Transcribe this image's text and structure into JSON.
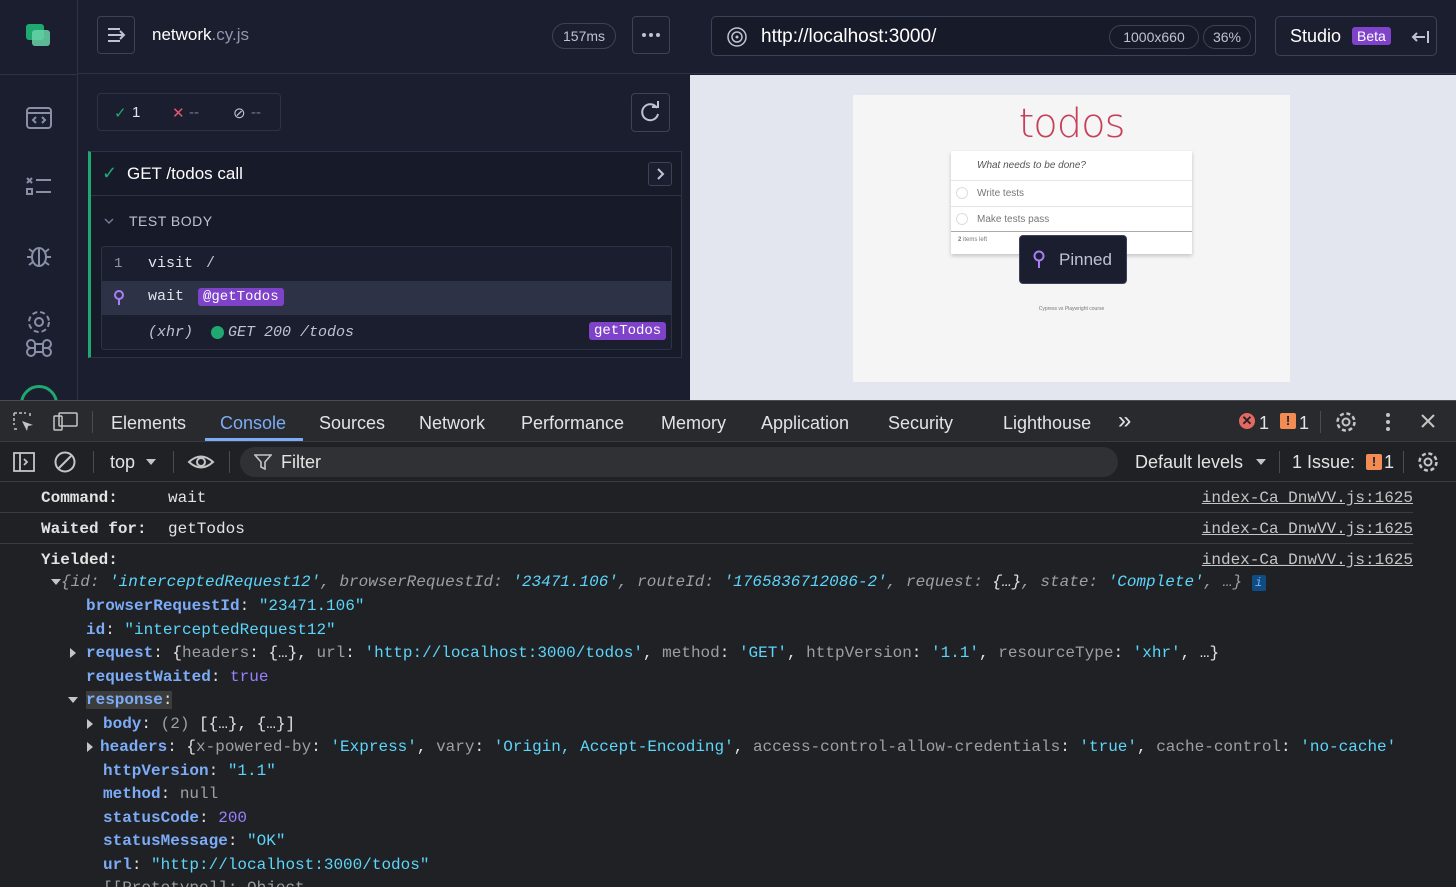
{
  "reporter": {
    "spec_name": "network",
    "spec_ext": ".cy.js",
    "duration": "157ms",
    "stats": {
      "passed": "1",
      "failed": "--",
      "pending": "--"
    },
    "test_title": "GET /todos call",
    "body_heading": "TEST BODY",
    "commands": [
      {
        "num": "1",
        "name": "visit",
        "arg": "/"
      },
      {
        "name": "wait",
        "alias": "@getTodos"
      },
      {
        "name": "(xhr)",
        "detail": "GET 200 /todos",
        "alias": "getTodos"
      }
    ]
  },
  "preview": {
    "url": "http://localhost:3000/",
    "viewport": "1000x660",
    "zoom": "36%",
    "studio_label": "Studio",
    "beta_label": "Beta",
    "app": {
      "title": "todos",
      "input_placeholder": "What needs to be done?",
      "items": [
        "Write tests",
        "Make tests pass"
      ],
      "footer_count": "2",
      "footer_text": "items left",
      "credit": "Cypress vs Playwright course",
      "pinned_label": "Pinned"
    }
  },
  "devtools": {
    "tabs": [
      "Elements",
      "Console",
      "Sources",
      "Network",
      "Performance",
      "Memory",
      "Application",
      "Security",
      "Lighthouse"
    ],
    "more_tabs": "»",
    "error_count": "1",
    "warning_count": "1",
    "context": "top",
    "filter_placeholder": "Filter",
    "levels": "Default levels",
    "issues_label": "1 Issue:",
    "issues_count": "1",
    "source_link": "index-Ca_DnwVV.js:1625",
    "console": {
      "command_key": "Command:",
      "command_val": "wait",
      "waited_key": "Waited for:",
      "waited_val": "getTodos",
      "yielded_key": "Yielded:",
      "summary": {
        "id_key": "id",
        "id_val": "'interceptedRequest12'",
        "brid_key": "browserRequestId",
        "brid_val": "'23471.106'",
        "route_key": "routeId",
        "route_val": "'1765836712086-2'",
        "req_key": "request",
        "req_val": "{…}",
        "state_key": "state",
        "state_val": "'Complete'",
        "tail": ", …}"
      },
      "browserRequestId": "\"23471.106\"",
      "id": "\"interceptedRequest12\"",
      "request": {
        "headers_key": "headers",
        "headers_val": "{…}",
        "url_key": "url",
        "url_val": "'http://localhost:3000/todos'",
        "method_key": "method",
        "method_val": "'GET'",
        "http_key": "httpVersion",
        "http_val": "'1.1'",
        "rt_key": "resourceType",
        "rt_val": "'xhr'",
        "tail": ", …}"
      },
      "requestWaited": "true",
      "response_key": "response",
      "body_count": "(2)",
      "body_val": "[{…}, {…}]",
      "resp_headers": {
        "xpb_key": "x-powered-by",
        "xpb_val": "'Express'",
        "vary_key": "vary",
        "vary_val": "'Origin, Accept-Encoding'",
        "acac_key": "access-control-allow-credentials",
        "acac_val": "'true'",
        "cc_key": "cache-control",
        "cc_val": "'no-cache'"
      },
      "httpVersion": "\"1.1\"",
      "method": "null",
      "statusCode": "200",
      "statusMessage": "\"OK\"",
      "url": "\"http://localhost:3000/todos\"",
      "proto_line": "[[Prototype]]: Object"
    }
  }
}
